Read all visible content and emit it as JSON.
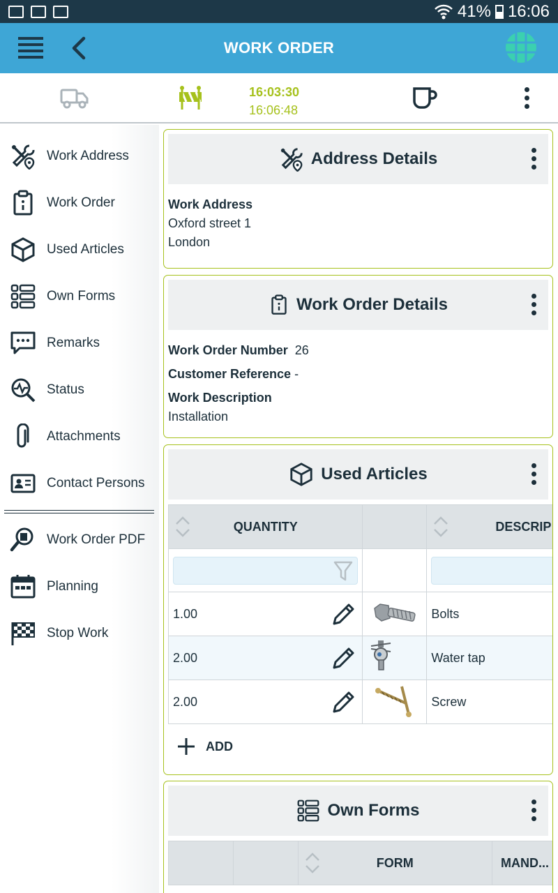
{
  "status_bar": {
    "battery": "41%",
    "time": "16:06"
  },
  "app_bar": {
    "title": "WORK ORDER"
  },
  "toolbar": {
    "time_start": "16:03:30",
    "time_now": "16:06:48"
  },
  "sidebar": {
    "items": [
      {
        "label": "Work Address",
        "icon": "tools-location-icon"
      },
      {
        "label": "Work Order",
        "icon": "clipboard-icon"
      },
      {
        "label": "Used Articles",
        "icon": "box-icon"
      },
      {
        "label": "Own Forms",
        "icon": "list-icon"
      },
      {
        "label": "Remarks",
        "icon": "chat-icon"
      },
      {
        "label": "Status",
        "icon": "status-search-icon"
      },
      {
        "label": "Attachments",
        "icon": "paperclip-icon"
      },
      {
        "label": "Contact Persons",
        "icon": "contact-card-icon"
      }
    ],
    "items2": [
      {
        "label": "Work Order PDF",
        "icon": "pdf-search-icon"
      },
      {
        "label": "Planning",
        "icon": "calendar-icon"
      },
      {
        "label": "Stop Work",
        "icon": "checkered-flag-icon"
      }
    ]
  },
  "address_card": {
    "title": "Address Details",
    "field_label": "Work Address",
    "line1": "Oxford street 1",
    "line2": "London"
  },
  "order_card": {
    "title": "Work Order Details",
    "number_label": "Work Order Number",
    "number_value": "26",
    "customer_label": "Customer Reference",
    "customer_value": "-",
    "description_label": "Work Description",
    "description_value": "Installation"
  },
  "articles_card": {
    "title": "Used Articles",
    "col_quantity": "QUANTITY",
    "col_description": "DESCRIP",
    "rows": [
      {
        "quantity": "1.00",
        "description": "Bolts"
      },
      {
        "quantity": "2.00",
        "description": "Water tap"
      },
      {
        "quantity": "2.00",
        "description": "Screw"
      }
    ],
    "add_label": "ADD"
  },
  "forms_card": {
    "title": "Own Forms",
    "col_form": "FORM",
    "col_mandatory": "MAND..."
  }
}
